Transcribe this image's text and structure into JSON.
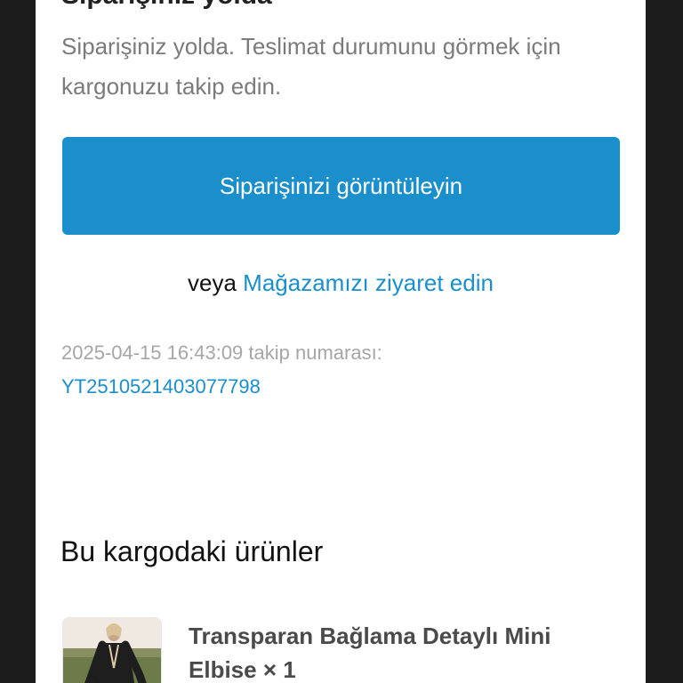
{
  "order": {
    "cut_heading": "Siparişiniz yolda",
    "intro_text": "Siparişiniz yolda. Teslimat durumunu görmek için kargonuzu takip edin.",
    "view_order_button": "Siparişinizi görüntüleyin",
    "or_text": "veya",
    "store_link": "Mağazamızı ziyaret edin",
    "tracking_meta": "2025-04-15 16:43:09 takip numarası:",
    "tracking_number": "YT2510521403077798"
  },
  "shipment": {
    "section_title": "Bu kargodaki ürünler",
    "items": [
      {
        "name": "Transparan Bağlama Detaylı Mini Elbise × 1"
      }
    ]
  },
  "colors": {
    "accent": "#1a8fcb",
    "muted_text": "#7b7b7b",
    "outer_background": "#1c1c1c"
  }
}
